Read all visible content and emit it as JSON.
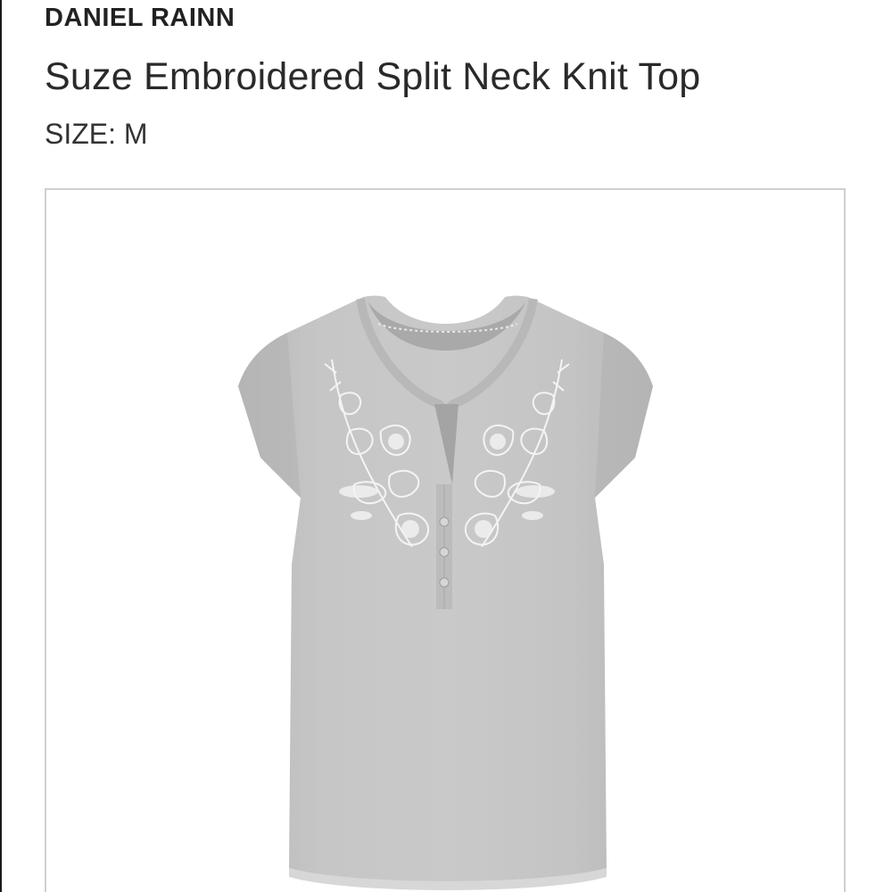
{
  "product": {
    "brand": "DANIEL RAINN",
    "name": "Suze Embroidered Split Neck Knit Top",
    "size_label": "SIZE: M"
  },
  "image": {
    "subject": "gray-knit-top",
    "colors": {
      "fabric": "#c4c4c4",
      "fabric_shadow": "#adadad",
      "embroidery": "#ffffff",
      "frame_border": "#cfcfcf"
    }
  }
}
